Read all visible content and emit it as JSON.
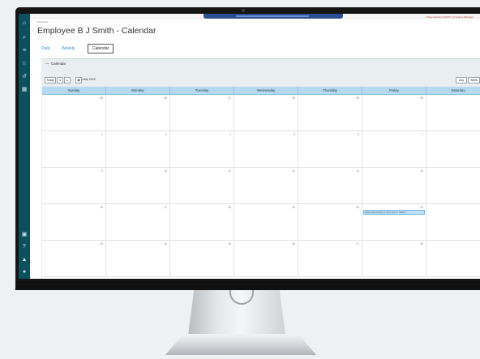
{
  "app": {
    "breadcrumb": "Employee  ›",
    "page_title": "Employee B J Smith - Calendar",
    "user_links": "Chloe Harrison (SOFT) v4   System Manager"
  },
  "tabs": [
    {
      "label": "Daily",
      "active": false
    },
    {
      "label": "Weekly",
      "active": false
    },
    {
      "label": "Calendar",
      "active": true
    }
  ],
  "section": {
    "collapse_glyph": "—",
    "title": "Calendar"
  },
  "toolbar": {
    "today_label": "Today",
    "prev_glyph": "◂",
    "next_glyph": "▸",
    "date_picker_label": "May 2022",
    "right_buttons": [
      "Day",
      "Week"
    ]
  },
  "calendar": {
    "days": [
      "Sunday",
      "Monday",
      "Tuesday",
      "Wednesday",
      "Thursday",
      "Friday",
      "Saturday"
    ],
    "weeks": [
      [
        "25",
        "26",
        "27",
        "28",
        "29",
        "30",
        "1"
      ],
      [
        "2",
        "3",
        "4",
        "5",
        "6",
        "7",
        "8"
      ],
      [
        "9",
        "10",
        "11",
        "12",
        "13",
        "14",
        "15"
      ],
      [
        "16",
        "17",
        "18",
        "19",
        "20",
        "21",
        "22"
      ],
      [
        "23",
        "24",
        "25",
        "26",
        "27",
        "28",
        "29"
      ]
    ],
    "events": [
      {
        "week": 3,
        "day": 5,
        "label": "Labor Hours 8.00 | 1 Job | Sun 1: Status..."
      }
    ]
  },
  "colors": {
    "rail": "#0e4f5e",
    "header_blue": "#b6d9f1",
    "accent_link": "#3d8ec9"
  },
  "icons": [
    "home-icon",
    "search-icon",
    "list-icon",
    "star-icon",
    "history-icon",
    "grid-icon",
    "chat-icon",
    "help-icon",
    "bell-icon",
    "user-icon"
  ]
}
